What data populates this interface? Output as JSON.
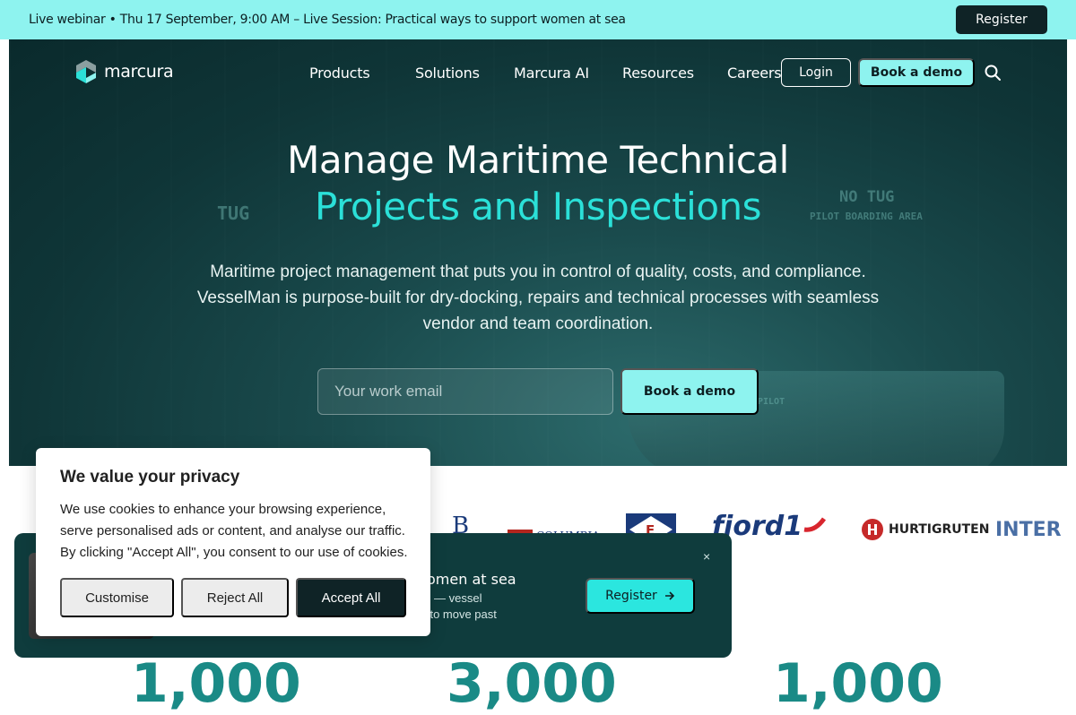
{
  "announcement": {
    "text": "Live webinar • Thu 17 September, 9:00 AM – Live Session: Practical ways to support women at sea",
    "register_label": "Register"
  },
  "nav": {
    "logo_text": "marcura",
    "items": [
      "Products",
      "Solutions",
      "Marcura AI",
      "Resources",
      "Careers"
    ],
    "login_label": "Login",
    "demo_label": "Book a demo"
  },
  "hero": {
    "title_line1": "Manage Maritime Technical",
    "title_line2": "Projects and Inspections",
    "subtitle": "Maritime project management that puts you in control of quality, costs, and compliance. VesselMan is purpose-built for dry-docking, repairs and technical processes with seamless vendor and team coordination.",
    "email_placeholder": "Your work email",
    "demo_label": "Book a demo",
    "background_labels": [
      "TUG",
      "NO TUG",
      "PILOT BOARDING AREA",
      "PILOT"
    ]
  },
  "client_logos": [
    "COLUMBIA",
    "fjord1",
    "HURTIGRUTEN",
    "INTER"
  ],
  "stats_partial": [
    "1,000",
    "3,000",
    "1,000"
  ],
  "webinar_popup": {
    "title_partial": "omen at sea",
    "line1_partial": "— vessel",
    "line2_partial": "g — to move past",
    "register_label": "Register",
    "close_symbol": "×"
  },
  "cookie_banner": {
    "title": "We value your privacy",
    "text": "We use cookies to enhance your browsing experience, serve personalised ads or content, and analyse our traffic. By clicking \"Accept All\", you consent to our use of cookies.",
    "customise_label": "Customise",
    "reject_label": "Reject All",
    "accept_label": "Accept All"
  },
  "colors": {
    "accent": "#8ef3ef",
    "accent_text": "#2be0d8",
    "dark": "#0f2326",
    "hero_bg": "#0f3537"
  }
}
